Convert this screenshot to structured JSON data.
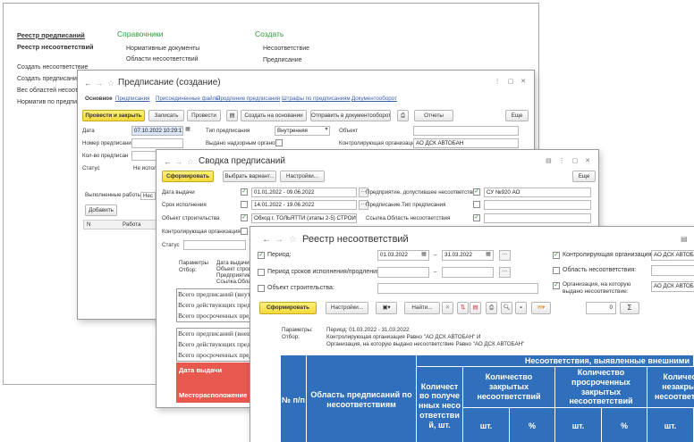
{
  "main_menu": {
    "left_items": [
      "Реестр предписаний",
      "Реестр несоответствий",
      "Создать несоответствие",
      "Создать предписание",
      "Вес областей несоотв",
      "Норматив по предпис"
    ],
    "col2_title": "Справочники",
    "col2_items": [
      "Нормативные документы",
      "Области несоответствий"
    ],
    "col3_title": "Создать",
    "col3_items": [
      "Несоответствие",
      "Предписание"
    ]
  },
  "win1": {
    "title": "Предписание (создание)",
    "tabs": [
      "Основное",
      "Предписания",
      "Присоединенные файлы",
      "Продление предписания",
      "Штрафы по предписаниям",
      "Документооборот"
    ],
    "buttons": {
      "post_close": "Провести и закрыть",
      "save": "Записать",
      "post": "Провести",
      "create_based": "Создать на основании",
      "send": "Отправить в документооборот",
      "reports": "Отчеты",
      "more": "Еще"
    },
    "fields": {
      "date_label": "Дата",
      "date_value": "07.10.2022 10:29:17",
      "number_label": "Номер предписания",
      "count_label": "Кол-во предписан",
      "status_label": "Статус",
      "status_value": "Не испол",
      "type_label": "Тип предписания",
      "type_value": "Внутренняя",
      "issued_label": "Выдано надзорным органом",
      "object_label": "Объект",
      "control_org_label": "Контролирующая организация",
      "control_org_value": "АО ДСК АВТОБАН"
    },
    "subtabs": [
      "Выполненные работы",
      "Нес"
    ],
    "add_button": "Добавить",
    "grid_headers": [
      "N",
      "Работа"
    ]
  },
  "win2": {
    "title": "Сводка предписаний",
    "buttons": {
      "form": "Сформировать",
      "variant": "Выбрать вариант...",
      "settings": "Настройки...",
      "more": "Еще"
    },
    "fields": {
      "issue_date_label": "Дата выдачи",
      "issue_date_value": "01.01.2022 - 09.06.2022",
      "deadline_label": "Срок исполнения",
      "deadline_value": "14.01.2022 - 19.06.2022",
      "object_label": "Объект строительства",
      "object_value": "Обход г. ТОЛЬЯТТИ (этапы 2-5) СТРОИТЕ",
      "control_org_label": "Контролирующая организация",
      "status_label": "Статус",
      "company_label": "Предприятие, допустившее несоответствие",
      "company_value": "СУ №920 АО",
      "type_label": "Предписание.Тип предписания",
      "area_link_label": "Ссылка.Область несоответствия"
    },
    "params": [
      "Параметры",
      "Отбор:"
    ],
    "params_vals": [
      "Дата выдачи",
      "Объект строит",
      "Предприятие,",
      "Ссылка.Обла"
    ],
    "summary_rows": [
      "Всего предписаний (внут",
      "Всего действующих предп",
      "Всего просроченных предп",
      "Всего предписаний (внеш",
      "Всего действующих предп",
      "Всего просроченных пред"
    ],
    "red_headers": [
      "Дата выдачи",
      "Месторасположение"
    ]
  },
  "win3": {
    "title": "Реестр несоответствий",
    "fields": {
      "period_label": "Период:",
      "period_from": "01.03.2022",
      "period_to": "31.03.2022",
      "dash": "–",
      "period_deadline_label": "Период сроков исполнения/продления:",
      "object_label": "Объект строительства:",
      "control_org_label": "Контролирующая организация:",
      "control_org_value": "АО ДСК АВТОБАН",
      "area_label": "Область несоответствия:",
      "issued_org_label": "Организация, на которую выдано несоответствие:",
      "issued_org_value": "АО ДСК АВТОБАН"
    },
    "buttons": {
      "form": "Сформировать",
      "settings": "Настройки...",
      "find": "Найти...",
      "counter": "0",
      "sigma": "Σ"
    },
    "params_label": "Параметры:",
    "params_value": "Период: 01.03.2022 - 31.03.2022",
    "filter_label": "Отбор:",
    "filter_value_1": "Контролирующая организация Равно \"АО ДСК АВТОБАН\" И",
    "filter_value_2": "Организация, на которую выдано несоответствие Равно \"АО ДСК АВТОБАН\"",
    "table": {
      "col_num": "№ п/п",
      "col_area": "Область предписаний по несоответствиям",
      "col_count": "Количество полученных несоответствий, шт.",
      "group_title": "Несоответствия, выявленные внешними",
      "sub_closed": "Количество закрытых несоответствий",
      "sub_overdue": "Количество просроченных закрытых несоответствий",
      "sub_unclosed": "Количество незакрытых несоответствий",
      "unit_pcs": "шт.",
      "unit_pct": "%"
    }
  },
  "colors": {
    "header_blue": "#2f6fbb",
    "accent_yellow": "#f5dd3e",
    "red_header": "#e8584f",
    "menu_green": "#2e9a39"
  }
}
